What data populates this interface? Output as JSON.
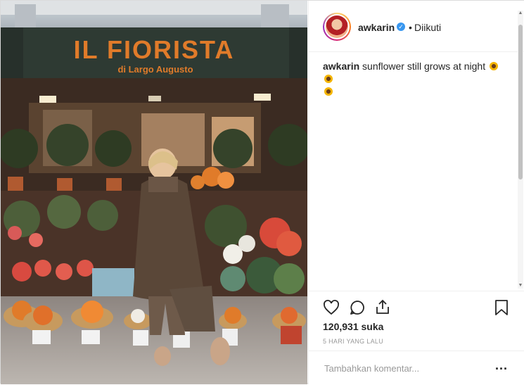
{
  "post": {
    "username": "awkarin",
    "verified_icon": "verified-badge-icon",
    "separator": "•",
    "follow_status": "Diikuti",
    "caption_user": "awkarin",
    "caption_text": "sunflower still grows at night",
    "likes": "120,931 suka",
    "timestamp": "5 HARI YANG LALU",
    "comment_placeholder": "Tambahkan komentar...",
    "more_label": "..."
  },
  "photo": {
    "sign_title": "IL FIORISTA",
    "sign_subtitle": "di Largo Augusto"
  },
  "icons": {
    "like": "heart-icon",
    "comment": "comment-icon",
    "share": "share-icon",
    "save": "bookmark-icon"
  },
  "colors": {
    "link": "#3897f0",
    "text": "#262626",
    "muted": "#999999",
    "sign_bg": "#2e3a33",
    "sign_text": "#e07b2a"
  }
}
